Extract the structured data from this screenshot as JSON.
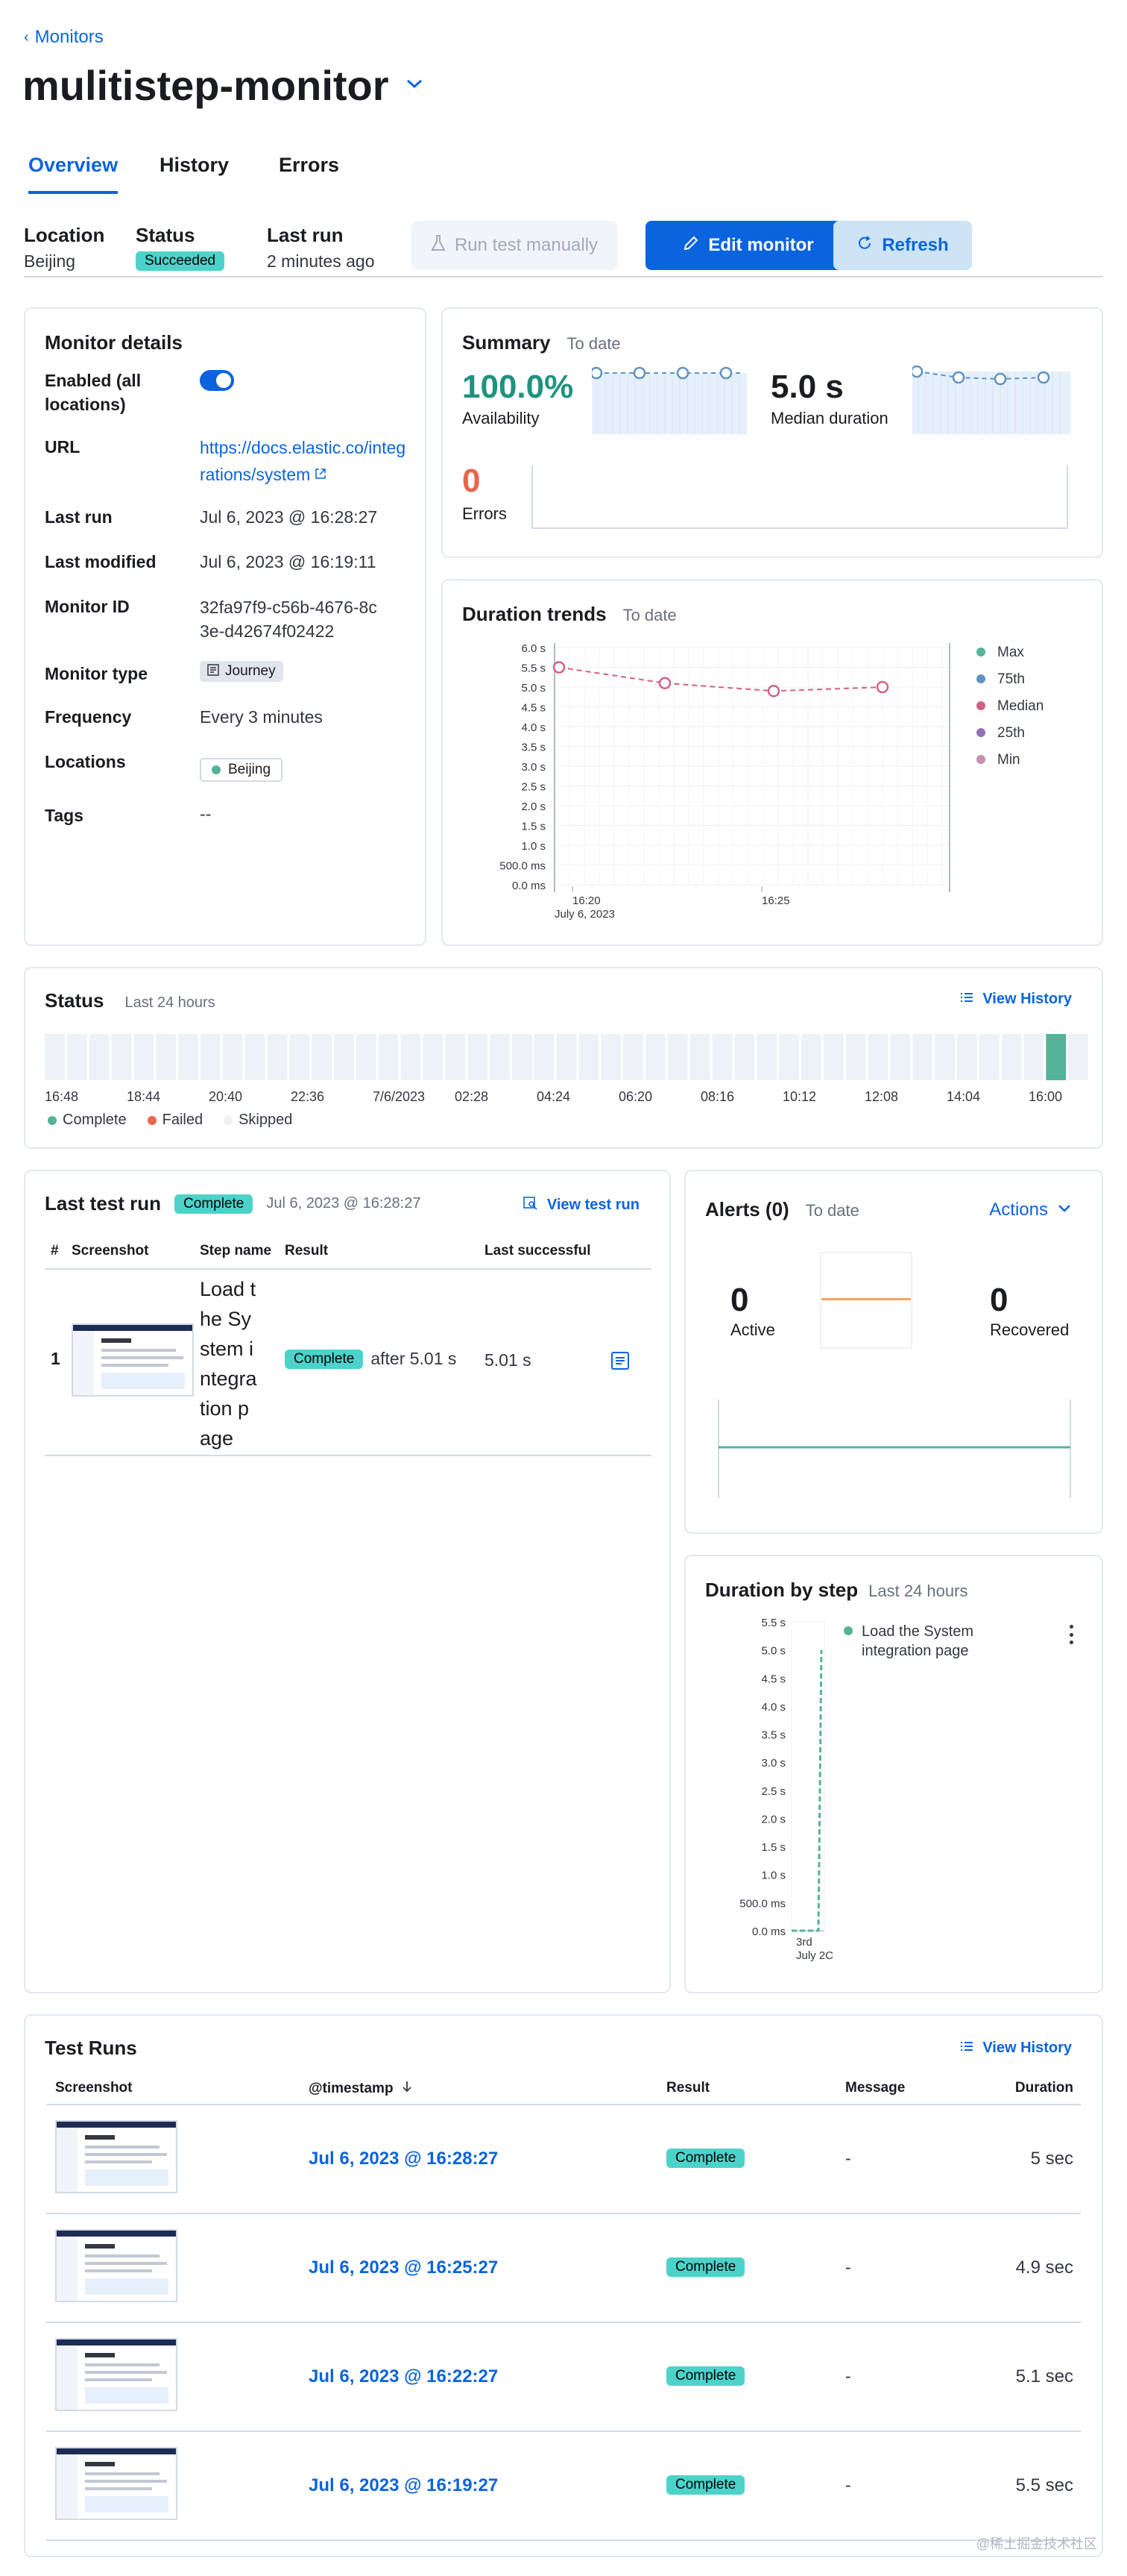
{
  "breadcrumb": {
    "back_label": "Monitors"
  },
  "page": {
    "title": "mulitistep-monitor"
  },
  "tabs": [
    {
      "label": "Overview"
    },
    {
      "label": "History"
    },
    {
      "label": "Errors"
    }
  ],
  "header_meta": {
    "location_label": "Location",
    "location_value": "Beijing",
    "status_label": "Status",
    "status_value": "Succeeded",
    "last_run_label": "Last run",
    "last_run_value": "2 minutes ago"
  },
  "toolbar": {
    "run_test_label": "Run test manually",
    "edit_label": "Edit monitor",
    "refresh_label": "Refresh"
  },
  "monitor_details": {
    "title": "Monitor details",
    "enabled_label": "Enabled (all locations)",
    "url_label": "URL",
    "url_value": "https://docs.elastic.co/integrations/system",
    "last_run_label": "Last run",
    "last_run_value": "Jul 6, 2023 @ 16:28:27",
    "last_modified_label": "Last modified",
    "last_modified_value": "Jul 6, 2023 @ 16:19:11",
    "monitor_id_label": "Monitor ID",
    "monitor_id_value": "32fa97f9-c56b-4676-8c3e-d42674f02422",
    "type_label": "Monitor type",
    "type_value": "Journey",
    "frequency_label": "Frequency",
    "frequency_value": "Every 3 minutes",
    "locations_label": "Locations",
    "locations_value": "Beijing",
    "tags_label": "Tags",
    "tags_value": "--"
  },
  "summary": {
    "title": "Summary",
    "subtitle": "To date",
    "availability_value": "100.0%",
    "availability_label": "Availability",
    "median_value": "5.0 s",
    "median_label": "Median duration",
    "errors_value": "0",
    "errors_label": "Errors"
  },
  "duration_trends": {
    "title": "Duration trends",
    "subtitle": "To date"
  },
  "status_panel": {
    "title": "Status",
    "subtitle": "Last 24 hours",
    "view_history": "View History",
    "ticks": [
      "16:48",
      "18:44",
      "20:40",
      "22:36",
      "7/6/2023",
      "02:28",
      "04:24",
      "06:20",
      "08:16",
      "10:12",
      "12:08",
      "14:04",
      "16:00"
    ],
    "legend": [
      {
        "label": "Complete",
        "color": "#54b399"
      },
      {
        "label": "Failed",
        "color": "#e7664c"
      },
      {
        "label": "Skipped",
        "color": "#eef1f5"
      }
    ]
  },
  "last_test_run": {
    "title": "Last test run",
    "badge": "Complete",
    "date": "Jul 6, 2023 @ 16:28:27",
    "view_link": "View test run",
    "columns": [
      "#",
      "Screenshot",
      "Step name",
      "Result",
      "Last successful"
    ],
    "step": {
      "index": "1",
      "name": "Load the System integration page",
      "result_badge": "Complete",
      "result_text": "after 5.01 s",
      "last_successful": "5.01 s"
    }
  },
  "alerts": {
    "title": "Alerts (0)",
    "subtitle": "To date",
    "actions_label": "Actions",
    "active_value": "0",
    "active_label": "Active",
    "recovered_value": "0",
    "recovered_label": "Recovered"
  },
  "duration_by_step": {
    "title": "Duration by step",
    "subtitle": "Last 24 hours",
    "legend_label": "Load the System integration page"
  },
  "test_runs": {
    "title": "Test Runs",
    "view_history": "View History",
    "columns": {
      "screenshot": "Screenshot",
      "timestamp": "@timestamp",
      "result": "Result",
      "message": "Message",
      "duration": "Duration"
    },
    "rows": [
      {
        "timestamp": "Jul 6, 2023 @ 16:28:27",
        "result": "Complete",
        "message": "-",
        "duration": "5 sec"
      },
      {
        "timestamp": "Jul 6, 2023 @ 16:25:27",
        "result": "Complete",
        "message": "-",
        "duration": "4.9 sec"
      },
      {
        "timestamp": "Jul 6, 2023 @ 16:22:27",
        "result": "Complete",
        "message": "-",
        "duration": "5.1 sec"
      },
      {
        "timestamp": "Jul 6, 2023 @ 16:19:27",
        "result": "Complete",
        "message": "-",
        "duration": "5.5 sec"
      }
    ]
  },
  "watermark": "@稀土掘金技术社区",
  "chart_data": [
    {
      "type": "line",
      "title": "Duration trends",
      "subtitle": "To date",
      "yticks": [
        "6.0 s",
        "5.5 s",
        "5.0 s",
        "4.5 s",
        "4.0 s",
        "3.5 s",
        "3.0 s",
        "2.5 s",
        "2.0 s",
        "1.5 s",
        "1.0 s",
        "500.0 ms",
        "0.0 ms"
      ],
      "xticks": [
        "16:20",
        "16:25"
      ],
      "xsub": "July 6, 2023",
      "ylim": [
        0,
        6.0
      ],
      "legend": [
        {
          "name": "Max",
          "color": "#54b399"
        },
        {
          "name": "75th",
          "color": "#6092c0"
        },
        {
          "name": "Median",
          "color": "#d36086"
        },
        {
          "name": "25th",
          "color": "#9170b8"
        },
        {
          "name": "Min",
          "color": "#ca8eae"
        }
      ],
      "series": [
        {
          "name": "Median",
          "color": "#d36086",
          "x": [
            "16:19",
            "16:22",
            "16:25",
            "16:28"
          ],
          "values": [
            5.5,
            5.1,
            4.9,
            5.0
          ]
        }
      ]
    },
    {
      "type": "line",
      "title": "Duration by step",
      "subtitle": "Last 24 hours",
      "yticks": [
        "5.5 s",
        "5.0 s",
        "4.5 s",
        "4.0 s",
        "3.5 s",
        "3.0 s",
        "2.5 s",
        "2.0 s",
        "1.5 s",
        "1.0 s",
        "500.0 ms",
        "0.0 ms"
      ],
      "xticks": [
        "3rd"
      ],
      "xsub": "July 2C",
      "ylim": [
        0,
        5.5
      ],
      "series": [
        {
          "name": "Load the System integration page",
          "color": "#54b399",
          "values": [
            0,
            5.0
          ]
        }
      ]
    }
  ]
}
